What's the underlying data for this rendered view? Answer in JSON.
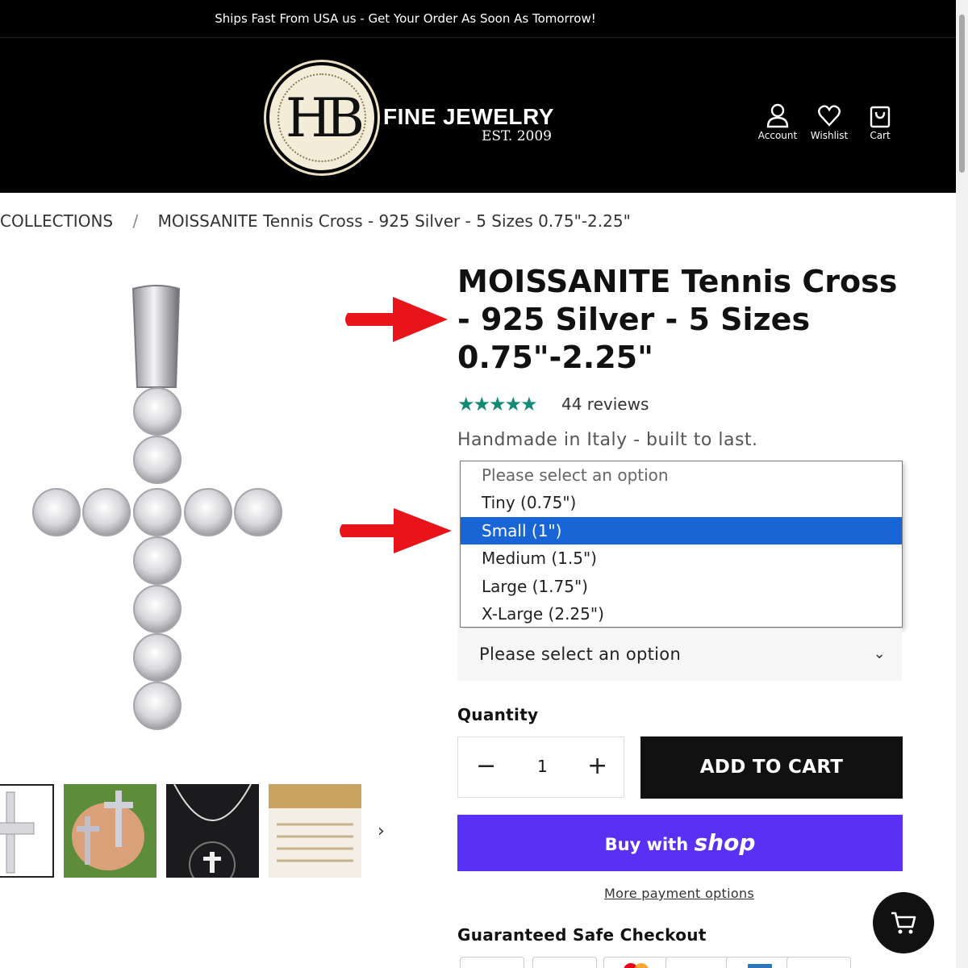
{
  "announcement": "Ships Fast From USA us - Get Your Order As Soon As Tomorrow!",
  "brand": {
    "monogram": "HB",
    "name": "FINE JEWELRY",
    "est": "EST. 2009"
  },
  "header_icons": [
    {
      "label": "Account",
      "icon": "user-icon"
    },
    {
      "label": "Wishlist",
      "icon": "heart-icon"
    },
    {
      "label": "Cart",
      "icon": "shopping-bag-icon"
    }
  ],
  "breadcrumb": {
    "parent": "COLLECTIONS",
    "separator": "/",
    "current": "MOISSANITE Tennis Cross - 925 Silver - 5 Sizes 0.75\"-2.25\""
  },
  "product": {
    "title": "MOISSANITE Tennis Cross - 925 Silver - 5 Sizes 0.75\"-2.25\"",
    "stars": "★★★★★",
    "rating": 5,
    "reviews": "44 reviews",
    "tagline": "Handmade in Italy - built to last."
  },
  "size_dropdown": {
    "options": [
      "Please select an option",
      "Tiny (0.75\")",
      "Small (1\")",
      "Medium (1.5\")",
      "Large (1.75\")",
      "X-Large (2.25\")"
    ],
    "highlighted": "Small (1\")"
  },
  "select_box": {
    "value": "Please select an option",
    "chevron": "⌄"
  },
  "quantity": {
    "label": "Quantity",
    "value": "1",
    "minus": "−",
    "plus": "+"
  },
  "buttons": {
    "add_to_cart": "ADD TO CART",
    "buy_with": "Buy with",
    "shop_brand": "shop",
    "more_payment": "More payment options"
  },
  "safe_checkout": "Guaranteed Safe Checkout",
  "thumb_next": "›",
  "colors": {
    "accent_green": "#148a74",
    "shop_purple": "#5a31f4",
    "highlight_blue": "#1a65d6",
    "annotation_red": "#e8141a"
  }
}
